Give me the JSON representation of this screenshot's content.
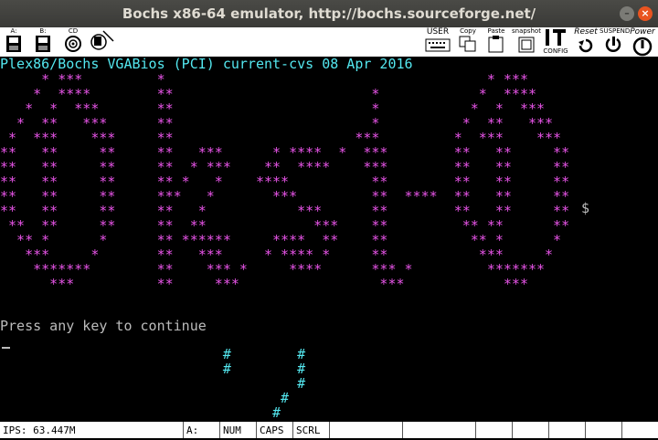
{
  "window": {
    "title": "Bochs x86-64 emulator, http://bochs.sourceforge.net/",
    "minimize_icon": "minimize-icon",
    "close_icon": "close-icon"
  },
  "toolbar": {
    "drive_a": "A:",
    "drive_b": "B:",
    "cdrom": "CD",
    "user": "USER",
    "copy": "Copy",
    "paste": "Paste",
    "snapshot": "snapshot",
    "config": "CONFIG",
    "reset": "Reset",
    "suspend": "SUSPEND",
    "power": "Power"
  },
  "screen": {
    "bios_line": "Plex86/Bochs VGABios (PCI) current-cvs 08 Apr 2016",
    "logo_lines": [
      "     * ***         *                                       * ***",
      "    *  ****        **                        *            *  ****",
      "   *  *  ***       **                        *           *  *  ***",
      "  *  **   ***      **                        *          *  **   ***",
      " *  ***    ***     **                      ***         *  ***    ***",
      "**   **     **     **   ***      * ****  *  ***        **   **     **",
      "**   **     **     **  * ***    **  ****    ***        **   **     **",
      "**   **     **     ** *   *    ****          **        **   **     **",
      "**   **     **     ***   *       ***         **  ****  **   **     **",
      "**   **     **     **   *           ***      **        **   **     **",
      " **  **     **     **  **             ***    **         ** **      **",
      "  ** *      *      ** ******     ****  **    **          ** *      *",
      "   ***     *       **   ***     * **** *     **           ***     *",
      "    *******        **    *** *     ****      *** *         *******",
      "      ***          **     ***                 ***            ***"
    ],
    "side_glyph": "$",
    "prompt": "Press any key to continue",
    "hash_lines": [
      "                           #        #",
      "                           #        #",
      "                                    #",
      "                                  #",
      "                                 #",
      "                               ##"
    ]
  },
  "status": {
    "ips": "IPS: 63.447M",
    "drive": "A:",
    "num": "NUM",
    "caps": "CAPS",
    "scrl": "SCRL"
  }
}
